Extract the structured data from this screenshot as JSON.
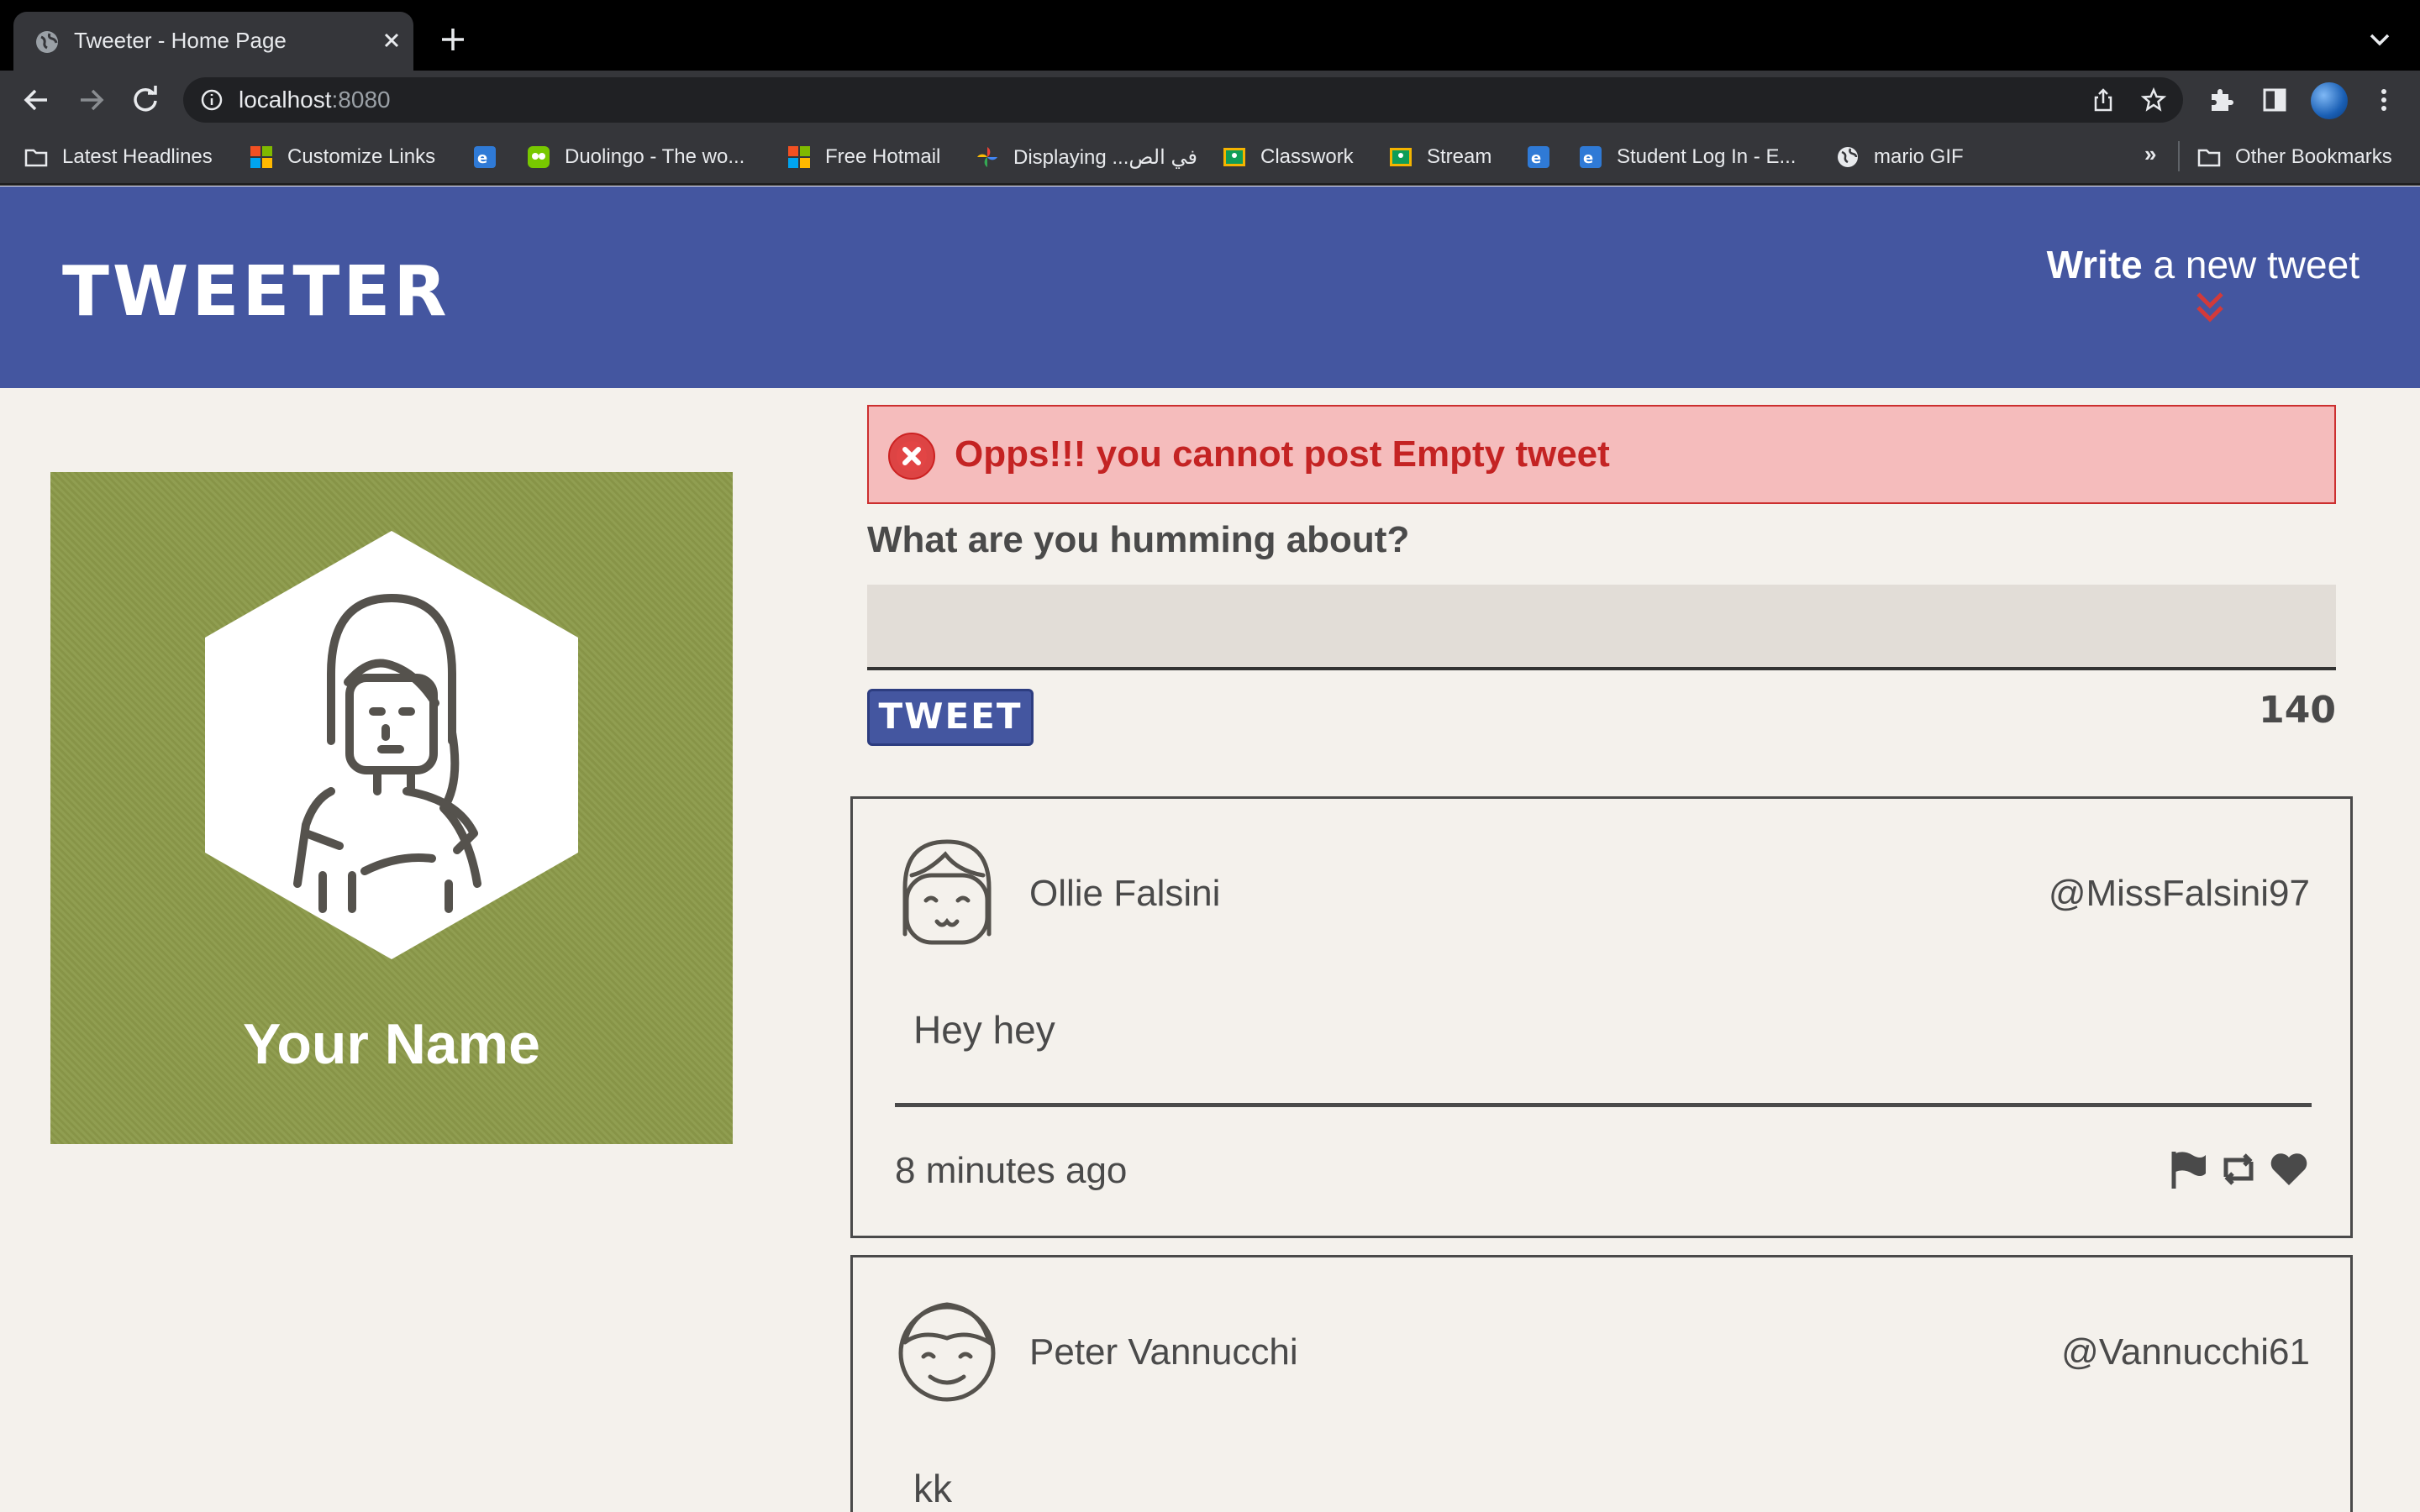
{
  "browser": {
    "tab_title": "Tweeter - Home Page",
    "url_host": "localhost",
    "url_port": ":8080",
    "bookmarks": [
      {
        "label": "Latest Headlines",
        "icon": "folder-icon"
      },
      {
        "label": "Customize Links",
        "icon": "microsoft-icon"
      },
      {
        "label": "",
        "icon": "edlink-icon"
      },
      {
        "label": "Duolingo - The wo...",
        "icon": "duolingo-icon"
      },
      {
        "label": "Free Hotmail",
        "icon": "microsoft-icon"
      },
      {
        "label": "Displaying ...في الص",
        "icon": "photos-icon"
      },
      {
        "label": "Classwork",
        "icon": "classroom-icon"
      },
      {
        "label": "Stream",
        "icon": "classroom-icon"
      },
      {
        "label": "",
        "icon": "edlink-icon"
      },
      {
        "label": "Student Log In - E...",
        "icon": "edlink-icon"
      },
      {
        "label": "mario GIF",
        "icon": "globe-icon"
      }
    ],
    "more_bookmarks": "»",
    "other_bookmarks": "Other Bookmarks"
  },
  "header": {
    "logo": "TWEETER",
    "write_bold": "Write",
    "write_rest": " a new tweet"
  },
  "profile": {
    "name": "Your Name"
  },
  "compose": {
    "error": "Opps!!! you cannot post Empty tweet",
    "label": "What are you humming about?",
    "input_value": "",
    "button": "TWEET",
    "counter": "140"
  },
  "tweets": [
    {
      "author": "Ollie Falsini",
      "handle": "@MissFalsini97",
      "text": "Hey hey",
      "time": "8 minutes ago"
    },
    {
      "author": "Peter Vannucchi",
      "handle": "@Vannucchi61",
      "text": "kk",
      "time": ""
    }
  ],
  "colors": {
    "header": "#4456a0",
    "page_bg": "#f4f1ec",
    "profile_bg": "#8c9a4a",
    "error_bg": "#f5bcbc",
    "error_text": "#c42323",
    "chevron": "#d23a3a"
  }
}
